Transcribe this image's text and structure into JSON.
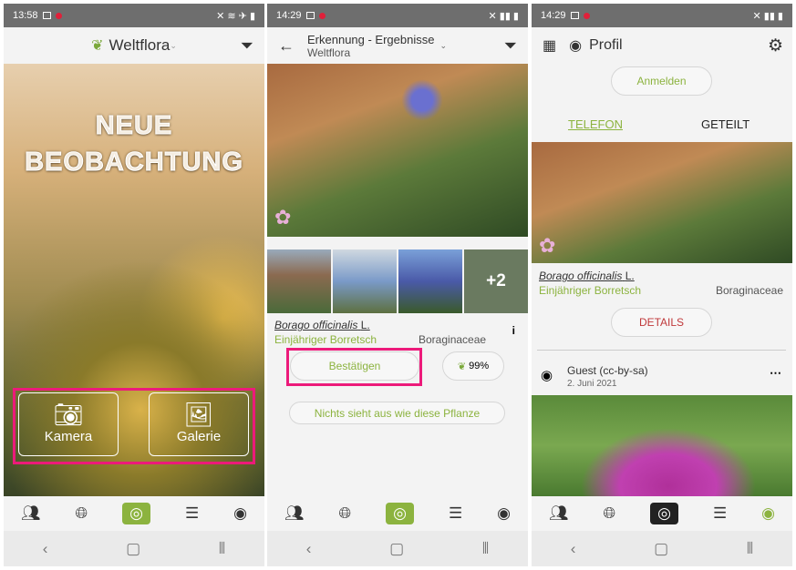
{
  "screen1": {
    "time": "13:58",
    "app_title": "Weltflora",
    "hero_line1": "NEUE",
    "hero_line2": "BEOBACHTUNG",
    "camera_label": "Kamera",
    "gallery_label": "Galerie"
  },
  "screen2": {
    "time": "14:29",
    "title": "Erkennung - Ergebnisse",
    "subtitle": "Weltflora",
    "more_count": "+2",
    "scientific_name": "Borago officinalis",
    "author": "L.",
    "common_name": "Einjähriger Borretsch",
    "family": "Boraginaceae",
    "confirm_label": "Bestätigen",
    "confidence": "99%",
    "none_label": "Nichts sieht aus wie diese Pflanze"
  },
  "screen3": {
    "time": "14:29",
    "title": "Profil",
    "login_label": "Anmelden",
    "tab_phone": "TELEFON",
    "tab_shared": "GETEILT",
    "scientific_name": "Borago officinalis",
    "author": "L.",
    "common_name": "Einjähriger Borretsch",
    "family": "Boraginaceae",
    "details_label": "DETAILS",
    "user": "Guest (cc-by-sa)",
    "date": "2. Juni 2021"
  },
  "colors": {
    "accent": "#8cb33f",
    "highlight": "#ec1a7a",
    "details": "#c0393b"
  }
}
